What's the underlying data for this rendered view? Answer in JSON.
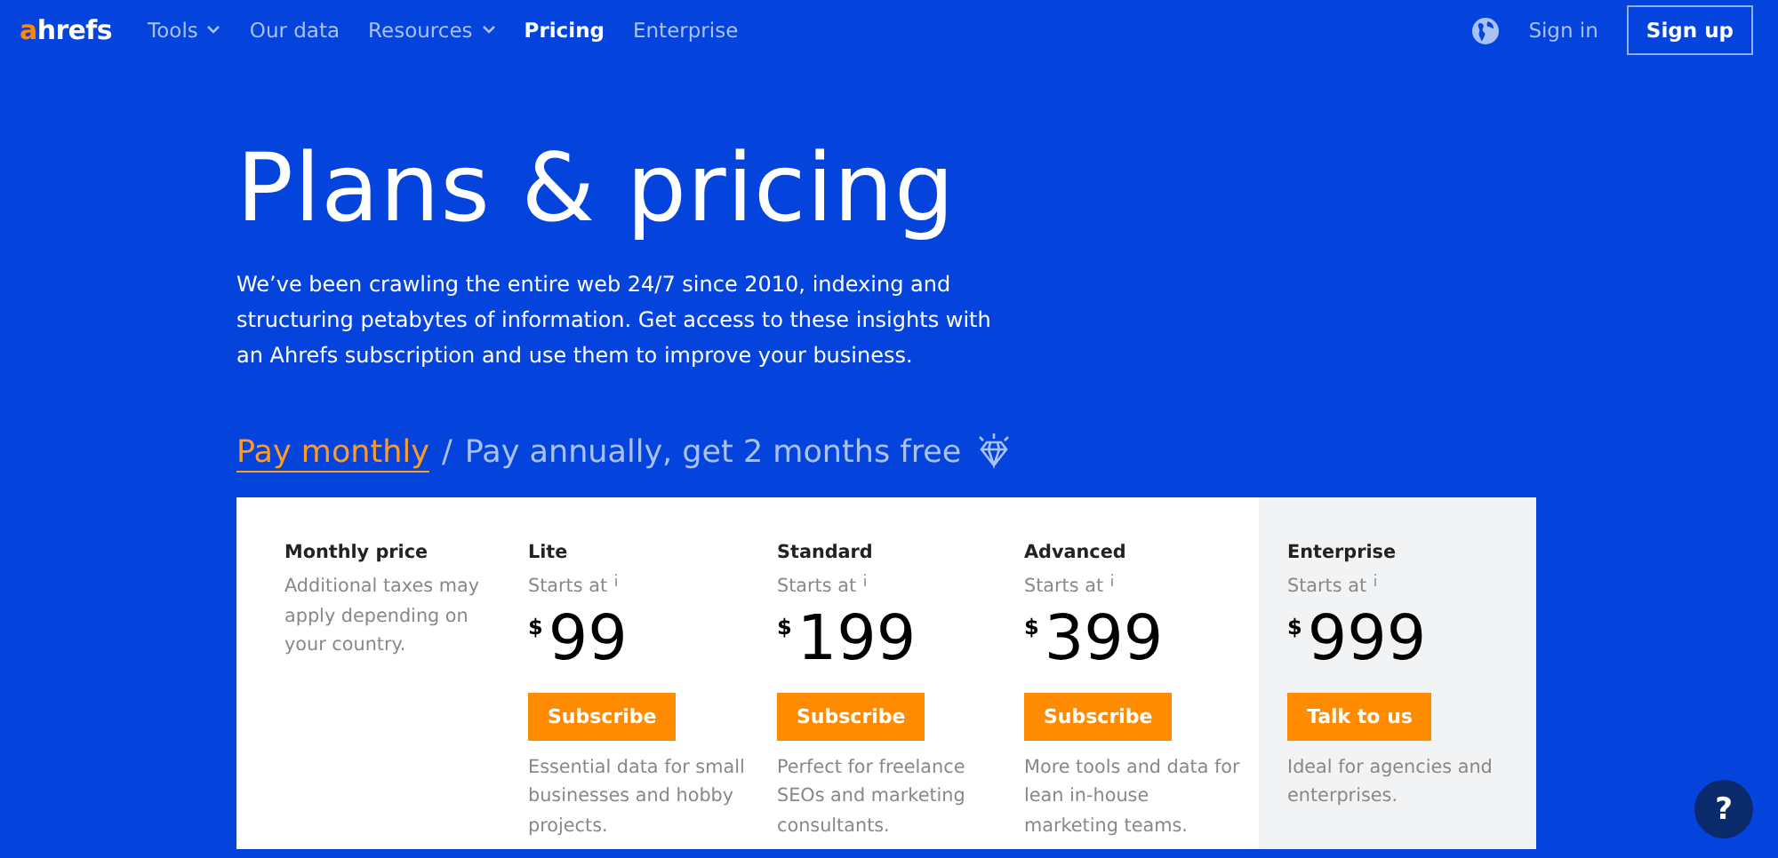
{
  "nav": {
    "logo": {
      "accent": "a",
      "rest": "hrefs"
    },
    "items": [
      {
        "label": "Tools",
        "has_menu": true,
        "selected": false
      },
      {
        "label": "Our data",
        "has_menu": false,
        "selected": false
      },
      {
        "label": "Resources",
        "has_menu": true,
        "selected": false
      },
      {
        "label": "Pricing",
        "has_menu": false,
        "selected": true
      },
      {
        "label": "Enterprise",
        "has_menu": false,
        "selected": false
      }
    ],
    "sign_in": "Sign in",
    "sign_up": "Sign up"
  },
  "hero": {
    "title": "Plans & pricing",
    "text": "We’ve been crawling the entire web 24/7 since 2010, indexing and structuring petabytes of information. Get access to these insights with an Ahrefs subscription and use them to improve your business."
  },
  "billing": {
    "options": [
      {
        "label": "Pay monthly",
        "selected": true
      },
      {
        "label": "Pay annually, get 2 months free",
        "selected": false
      }
    ],
    "separator": "/"
  },
  "pricing": {
    "label": {
      "title": "Monthly price",
      "note": "Additional taxes may apply depending on your country."
    },
    "plans": [
      {
        "name": "Lite",
        "starts": "Starts at",
        "currency": "$",
        "price": "99",
        "button": "Subscribe",
        "description": "Essential data for small businesses and hobby projects.",
        "highlighted": false
      },
      {
        "name": "Standard",
        "starts": "Starts at",
        "currency": "$",
        "price": "199",
        "button": "Subscribe",
        "description": "Perfect for freelance SEOs and marketing consultants.",
        "highlighted": false
      },
      {
        "name": "Advanced",
        "starts": "Starts at",
        "currency": "$",
        "price": "399",
        "button": "Subscribe",
        "description": "More tools and data for lean in-house marketing teams.",
        "highlighted": false
      },
      {
        "name": "Enterprise",
        "starts": "Starts at",
        "currency": "$",
        "price": "999",
        "button": "Talk to us",
        "description": "Ideal for agencies and enterprises.",
        "highlighted": true
      }
    ]
  },
  "help": "?"
}
